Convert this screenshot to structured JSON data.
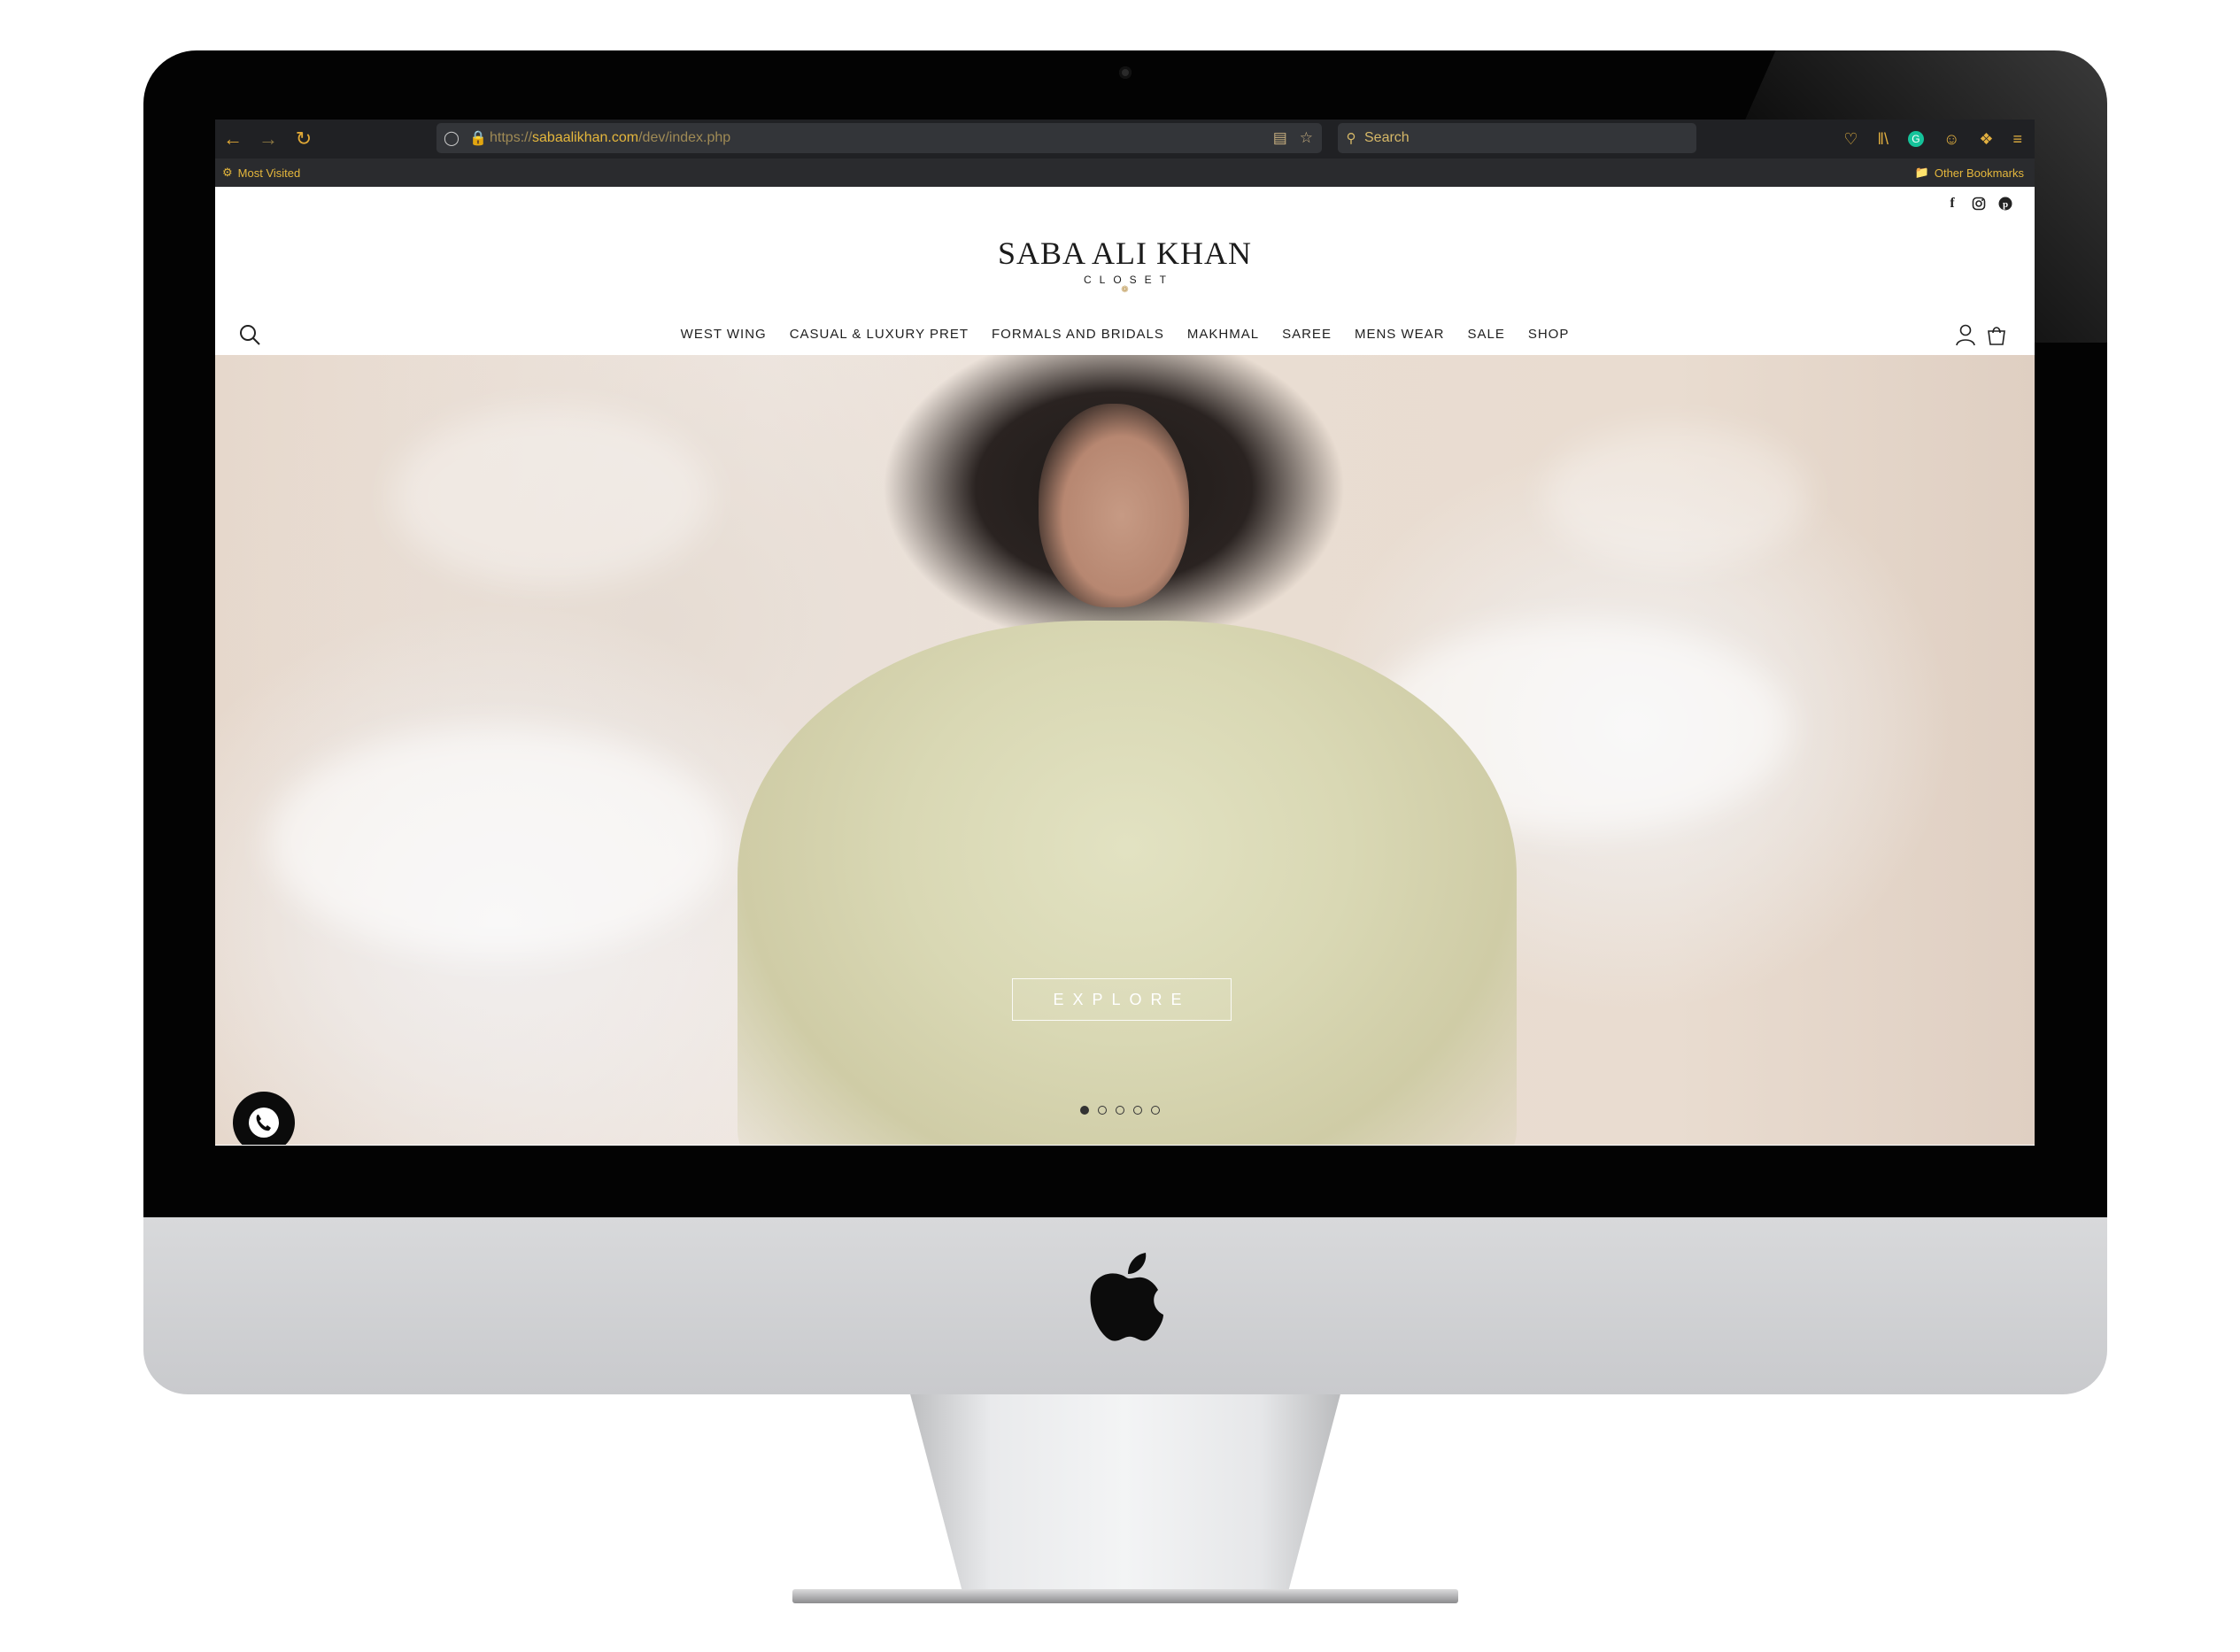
{
  "browser": {
    "url_prefix": "https://",
    "url_host": "sabaalikhan.com",
    "url_path": "/dev/index.php",
    "search_placeholder": "Search",
    "bookmarks_left": "Most Visited",
    "bookmarks_right": "Other Bookmarks"
  },
  "site": {
    "logo_main": "SABA ALI KHAN",
    "logo_sub": "CLOSET",
    "menu": [
      "WEST WING",
      "CASUAL & LUXURY PRET",
      "FORMALS AND BRIDALS",
      "MAKHMAL",
      "SAREE",
      "MENS WEAR",
      "SALE",
      "SHOP"
    ],
    "hero_button": "EXPLORE",
    "slider": {
      "count": 5,
      "active_index": 0
    },
    "social_icons": [
      "facebook-icon",
      "instagram-icon",
      "pinterest-icon"
    ]
  },
  "colors": {
    "browser_accent": "#e5b73c",
    "chrome_bg": "#202124",
    "logo_gold": "#b9924a"
  }
}
